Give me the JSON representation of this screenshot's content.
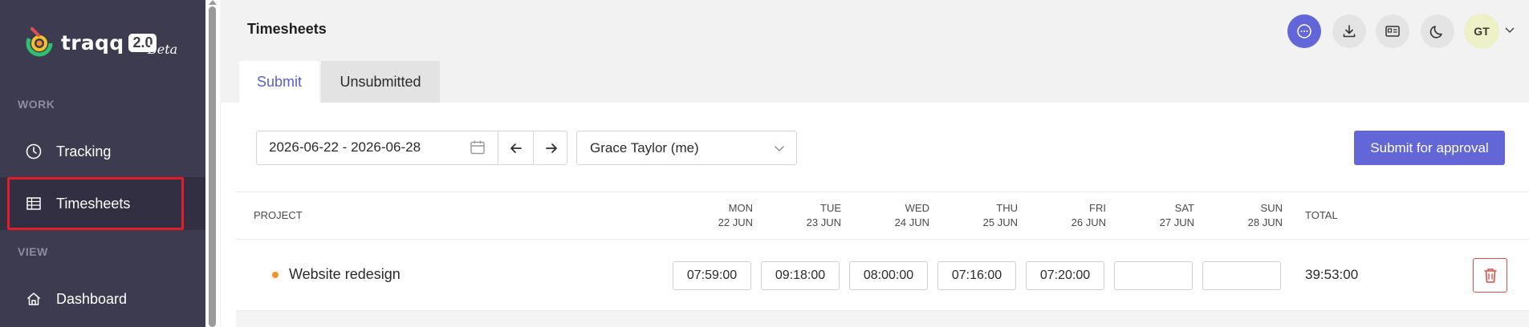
{
  "app": {
    "logo_word": "traqq",
    "logo_version": "2.0",
    "logo_tag": "Beta"
  },
  "sidebar": {
    "sections": [
      {
        "title": "WORK"
      },
      {
        "title": "VIEW"
      }
    ],
    "items": [
      {
        "label": "Tracking",
        "icon": "clock-icon"
      },
      {
        "label": "Timesheets",
        "icon": "table-grid-icon",
        "active": true
      },
      {
        "label": "Dashboard",
        "icon": "home-icon"
      }
    ]
  },
  "header": {
    "title": "Timesheets",
    "avatar_initials": "GT",
    "icons": [
      "chat-icon",
      "download-icon",
      "id-card-icon",
      "moon-icon",
      "chevron-down-icon"
    ]
  },
  "tabs": [
    {
      "label": "Submit",
      "active": true
    },
    {
      "label": "Unsubmitted",
      "active": false
    }
  ],
  "filters": {
    "date_range": "2026-06-22 - 2026-06-28",
    "user": "Grace Taylor (me)",
    "submit_label": "Submit for approval"
  },
  "table": {
    "project_header": "PROJECT",
    "total_header": "TOTAL",
    "days": [
      {
        "day": "MON",
        "date": "22 JUN"
      },
      {
        "day": "TUE",
        "date": "23 JUN"
      },
      {
        "day": "WED",
        "date": "24 JUN"
      },
      {
        "day": "THU",
        "date": "25 JUN"
      },
      {
        "day": "FRI",
        "date": "26 JUN"
      },
      {
        "day": "SAT",
        "date": "27 JUN"
      },
      {
        "day": "SUN",
        "date": "28 JUN"
      }
    ],
    "rows": [
      {
        "project": "Website redesign",
        "times": [
          "07:59:00",
          "09:18:00",
          "08:00:00",
          "07:16:00",
          "07:20:00",
          "",
          ""
        ],
        "total": "39:53:00"
      }
    ]
  },
  "colors": {
    "sidebar_bg": "#3d3b4f",
    "accent": "#6366d6",
    "project_dot": "#f5922a",
    "danger": "#e04a4a"
  }
}
